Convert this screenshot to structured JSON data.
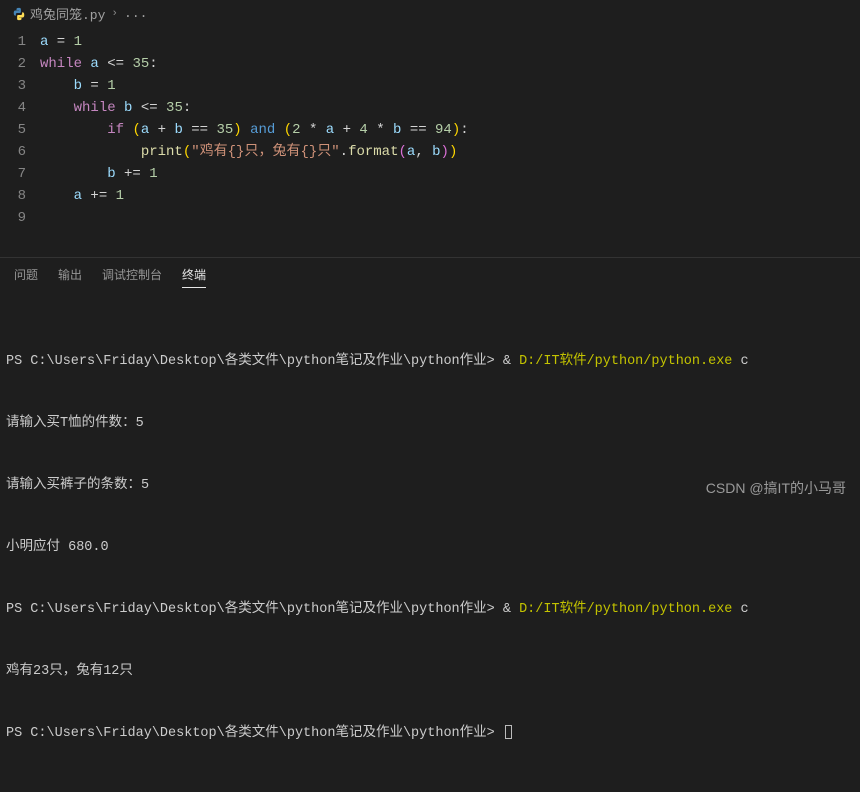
{
  "breadcrumb": {
    "filename": "鸡兔同笼.py",
    "rest": "..."
  },
  "code": {
    "lines": [
      {
        "n": "1",
        "tokens": [
          [
            "a",
            "var"
          ],
          [
            " = ",
            "op"
          ],
          [
            "1",
            "num"
          ]
        ]
      },
      {
        "n": "2",
        "tokens": [
          [
            "while",
            "kw"
          ],
          [
            " ",
            "op"
          ],
          [
            "a",
            "var"
          ],
          [
            " <= ",
            "op"
          ],
          [
            "35",
            "num"
          ],
          [
            ":",
            "op"
          ]
        ]
      },
      {
        "n": "3",
        "tokens": [
          [
            "    ",
            "op"
          ],
          [
            "b",
            "var"
          ],
          [
            " = ",
            "op"
          ],
          [
            "1",
            "num"
          ]
        ]
      },
      {
        "n": "4",
        "tokens": [
          [
            "    ",
            "op"
          ],
          [
            "while",
            "kw"
          ],
          [
            " ",
            "op"
          ],
          [
            "b",
            "var"
          ],
          [
            " <= ",
            "op"
          ],
          [
            "35",
            "num"
          ],
          [
            ":",
            "op"
          ]
        ]
      },
      {
        "n": "5",
        "tokens": [
          [
            "        ",
            "op"
          ],
          [
            "if",
            "kw"
          ],
          [
            " ",
            "op"
          ],
          [
            "(",
            "paren-y"
          ],
          [
            "a",
            "var"
          ],
          [
            " + ",
            "op"
          ],
          [
            "b",
            "var"
          ],
          [
            " == ",
            "op"
          ],
          [
            "35",
            "num"
          ],
          [
            ")",
            "paren-y"
          ],
          [
            " ",
            "op"
          ],
          [
            "and",
            "kw2"
          ],
          [
            " ",
            "op"
          ],
          [
            "(",
            "paren-y"
          ],
          [
            "2",
            "num"
          ],
          [
            " * ",
            "op"
          ],
          [
            "a",
            "var"
          ],
          [
            " + ",
            "op"
          ],
          [
            "4",
            "num"
          ],
          [
            " * ",
            "op"
          ],
          [
            "b",
            "var"
          ],
          [
            " == ",
            "op"
          ],
          [
            "94",
            "num"
          ],
          [
            ")",
            "paren-y"
          ],
          [
            ":",
            "op"
          ]
        ]
      },
      {
        "n": "6",
        "tokens": [
          [
            "            ",
            "op"
          ],
          [
            "print",
            "fn"
          ],
          [
            "(",
            "paren-y"
          ],
          [
            "\"鸡有{}只，兔有{}只\"",
            "str"
          ],
          [
            ".",
            "op"
          ],
          [
            "format",
            "fn"
          ],
          [
            "(",
            "paren-p"
          ],
          [
            "a",
            "var"
          ],
          [
            ", ",
            "op"
          ],
          [
            "b",
            "var"
          ],
          [
            ")",
            "paren-p"
          ],
          [
            ")",
            "paren-y"
          ]
        ]
      },
      {
        "n": "7",
        "tokens": [
          [
            "        ",
            "op"
          ],
          [
            "b",
            "var"
          ],
          [
            " += ",
            "op"
          ],
          [
            "1",
            "num"
          ]
        ]
      },
      {
        "n": "8",
        "tokens": [
          [
            "    ",
            "op"
          ],
          [
            "a",
            "var"
          ],
          [
            " += ",
            "op"
          ],
          [
            "1",
            "num"
          ]
        ]
      },
      {
        "n": "9",
        "tokens": []
      }
    ]
  },
  "panel": {
    "tabs": {
      "problems": "问题",
      "output": "输出",
      "debug": "调试控制台",
      "terminal": "终端"
    }
  },
  "terminal": {
    "prompt1": "PS C:\\Users\\Friday\\Desktop\\各类文件\\python笔记及作业\\python作业> ",
    "amp": "&",
    "cmd": " D:/IT软件/python/python.exe ",
    "trail": "c",
    "out1a": "请输入买T恤的件数：5",
    "out1b": "请输入买裤子的条数：5",
    "out1c": "小明应付 680.0",
    "prompt2": "PS C:\\Users\\Friday\\Desktop\\各类文件\\python笔记及作业\\python作业> ",
    "out2a": "鸡有23只，兔有12只",
    "prompt3": "PS C:\\Users\\Friday\\Desktop\\各类文件\\python笔记及作业\\python作业> "
  },
  "watermark": "CSDN @搞IT的小马哥"
}
